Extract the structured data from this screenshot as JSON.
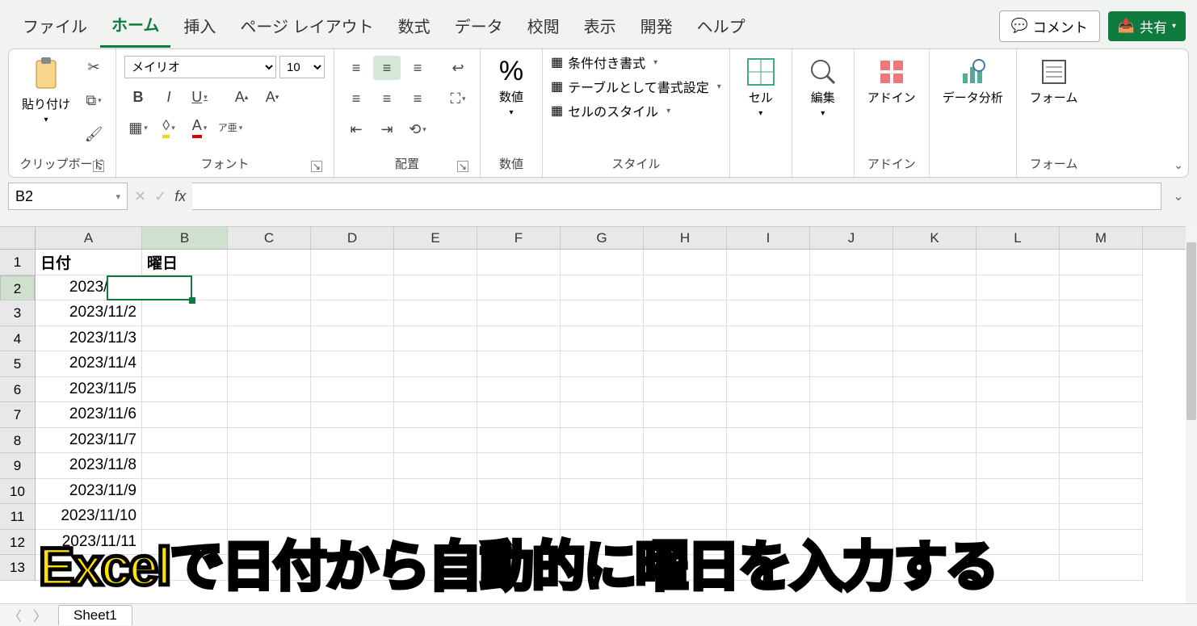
{
  "tabs": {
    "file": "ファイル",
    "home": "ホーム",
    "insert": "挿入",
    "pagelayout": "ページ レイアウト",
    "formulas": "数式",
    "data": "データ",
    "review": "校閲",
    "view": "表示",
    "dev": "開発",
    "help": "ヘルプ"
  },
  "topright": {
    "comment": "コメント",
    "share": "共有"
  },
  "ribbon": {
    "clipboard": {
      "paste": "貼り付け",
      "label": "クリップボード"
    },
    "font": {
      "name": "メイリオ",
      "size": "10",
      "label": "フォント",
      "phonetic": "ア亜"
    },
    "align": {
      "label": "配置"
    },
    "number": {
      "title": "数値",
      "label": "数値"
    },
    "styles": {
      "cond": "条件付き書式",
      "table": "テーブルとして書式設定",
      "cell": "セルのスタイル",
      "label": "スタイル"
    },
    "cells": {
      "title": "セル"
    },
    "editing": {
      "title": "編集"
    },
    "addins": {
      "title": "アドイン",
      "label": "アドイン"
    },
    "analysis": {
      "title": "データ分析"
    },
    "form": {
      "title": "フォーム",
      "label": "フォーム"
    }
  },
  "namebox": "B2",
  "columns": [
    "A",
    "B",
    "C",
    "D",
    "E",
    "F",
    "G",
    "H",
    "I",
    "J",
    "K",
    "L",
    "M"
  ],
  "rows": [
    "1",
    "2",
    "3",
    "4",
    "5",
    "6",
    "7",
    "8",
    "9",
    "10",
    "11",
    "12",
    "13"
  ],
  "hdr": {
    "a": "日付",
    "b": "曜日"
  },
  "dates": [
    "2023/11/1",
    "2023/11/2",
    "2023/11/3",
    "2023/11/4",
    "2023/11/5",
    "2023/11/6",
    "2023/11/7",
    "2023/11/8",
    "2023/11/9",
    "2023/11/10",
    "2023/11/11"
  ],
  "sheet": "Sheet1",
  "overlay": "Excelで日付から自動的に曜日を入力する"
}
